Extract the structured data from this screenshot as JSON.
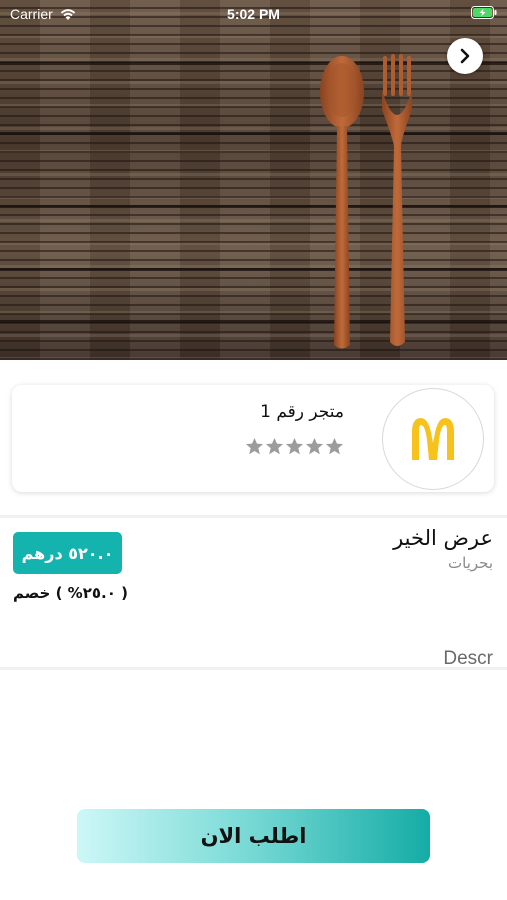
{
  "status_bar": {
    "carrier": "Carrier",
    "time": "5:02 PM",
    "wifi_icon": "wifi-icon",
    "battery_icon": "battery-charging-icon",
    "battery_color": "#4cd964"
  },
  "hero": {
    "back_icon": "chevron-right-icon",
    "image": "wooden-spoon-and-fork-on-wood-table"
  },
  "store": {
    "name": "متجر رقم 1",
    "logo": "mcdonalds-logo",
    "logo_color": "#f7c21b",
    "rating_max": 5,
    "rating": 0,
    "star_color": "#9c9c9c"
  },
  "offer": {
    "title": "عرض الخير",
    "category": "بحريات",
    "price": "٥٢٠.٠ درهم",
    "discount": "( ٢٥.٠% ) خصم",
    "description": "Descr",
    "accent_color": "#15b3ad"
  },
  "actions": {
    "order_label": "اطلب الان"
  }
}
